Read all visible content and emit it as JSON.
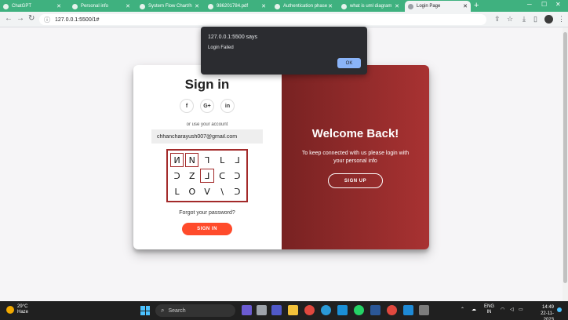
{
  "browser": {
    "tabs": [
      {
        "label": "ChatGPT"
      },
      {
        "label": "Personal info"
      },
      {
        "label": "System Flow Chart/h"
      },
      {
        "label": "986201784.pdf"
      },
      {
        "label": "Authentication phase"
      },
      {
        "label": "what is uml diagram"
      },
      {
        "label": "Login Page",
        "active": true
      }
    ],
    "new_tab": "+",
    "url": "127.0.0.1:5500/1#"
  },
  "alert": {
    "origin": "127.0.0.1:5500 says",
    "message": "Login Failed",
    "ok_label": "OK"
  },
  "signin": {
    "title": "Sign in",
    "social": [
      "f",
      "G+",
      "in"
    ],
    "or_text": "or use your account",
    "email_value": "chhancharayush007@gmail.com",
    "glyphs": [
      "И",
      "Ν",
      "ᒣ",
      "ᒪ",
      "ᒧ",
      "ᑐ",
      "Z",
      "ᒧ",
      "ᑕ",
      "ᑐ",
      "ᒪ",
      "Ο",
      "V",
      "\\",
      "ᑐ"
    ],
    "forgot": "Forgot your password?",
    "button": "SIGN IN"
  },
  "overlay": {
    "title": "Welcome Back!",
    "text": "To keep connected with us please login with your personal info",
    "button": "SIGN UP"
  },
  "taskbar": {
    "temp": "29°C",
    "condition": "Haze",
    "search": "Search",
    "lang": "ENG",
    "region": "IN",
    "time": "14:49",
    "date": "22-11-2023"
  },
  "colors": {
    "tab_green": "#3fb17f",
    "overlay_dark": "#782222",
    "overlay_light": "#a83232",
    "signin_button": "#ff4b2b",
    "alert_ok": "#8ab4f8"
  }
}
